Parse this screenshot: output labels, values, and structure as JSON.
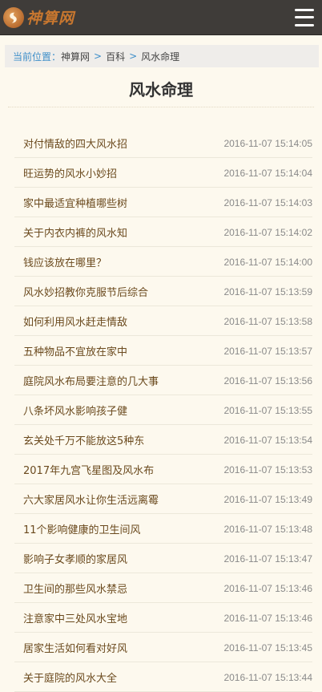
{
  "header": {
    "logo_text": "神算网",
    "colors": {
      "bar": "#3f3c39",
      "logo": "#c8772f"
    }
  },
  "breadcrumb": {
    "label": "当前位置：",
    "items": [
      "神算网",
      "百科",
      "风水命理"
    ],
    "separator": ">"
  },
  "page": {
    "title": "风水命理"
  },
  "articles": [
    {
      "title": "对付情敌的四大风水招",
      "date": "2016-11-07 15:14:05"
    },
    {
      "title": "旺运势的风水小妙招",
      "date": "2016-11-07 15:14:04"
    },
    {
      "title": "家中最适宜种植哪些树",
      "date": "2016-11-07 15:14:03"
    },
    {
      "title": "关于内衣内裤的风水知",
      "date": "2016-11-07 15:14:02"
    },
    {
      "title": "钱应该放在哪里？",
      "date": "2016-11-07 15:14:00"
    },
    {
      "title": "风水妙招教你克服节后综合",
      "date": "2016-11-07 15:13:59"
    },
    {
      "title": "如何利用风水赶走情敌",
      "date": "2016-11-07 15:13:58"
    },
    {
      "title": "五种物品不宜放在家中",
      "date": "2016-11-07 15:13:57"
    },
    {
      "title": "庭院风水布局要注意的几大事",
      "date": "2016-11-07 15:13:56"
    },
    {
      "title": "八条坏风水影响孩子健",
      "date": "2016-11-07 15:13:55"
    },
    {
      "title": "玄关处千万不能放这5种东",
      "date": "2016-11-07 15:13:54"
    },
    {
      "title": "2017年九宫飞星图及风水布",
      "date": "2016-11-07 15:13:53"
    },
    {
      "title": "六大家居风水让你生活远离霉",
      "date": "2016-11-07 15:13:49"
    },
    {
      "title": "11个影响健康的卫生间风",
      "date": "2016-11-07 15:13:48"
    },
    {
      "title": "影响子女孝顺的家居风",
      "date": "2016-11-07 15:13:47"
    },
    {
      "title": "卫生间的那些风水禁忌",
      "date": "2016-11-07 15:13:46"
    },
    {
      "title": "注意家中三处风水宝地",
      "date": "2016-11-07 15:13:46"
    },
    {
      "title": "居家生活如何看对好风",
      "date": "2016-11-07 15:13:45"
    },
    {
      "title": "关于庭院的风水大全",
      "date": "2016-11-07 15:13:44"
    }
  ]
}
